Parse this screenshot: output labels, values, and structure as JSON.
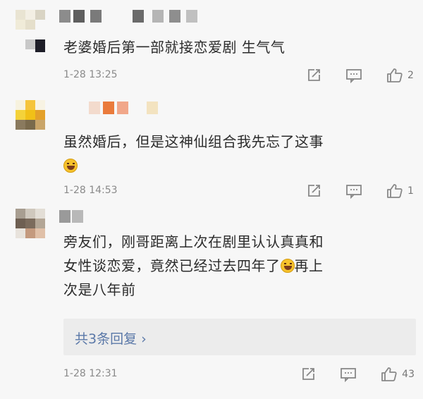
{
  "comments": [
    {
      "text": "老婆婚后第一部就接恋爱剧 生气气",
      "time": "1-28 13:25",
      "likes": "2"
    },
    {
      "text": "虽然婚后，但是这神仙组合我先忘了这事",
      "time": "1-28 14:53",
      "likes": "1"
    },
    {
      "text_line1": "旁友们，刚哥距离上次在剧里认认真真和",
      "text_line2a": "女性谈恋爱，竟然已经过去四年了",
      "text_line2b": "再上",
      "text_line3": "次是八年前",
      "replies_label": "共3条回复 ›",
      "time": "1-28 12:31",
      "likes": "43"
    }
  ],
  "icons": {
    "share": "share-icon",
    "comment": "comment-icon",
    "like": "thumbs-up-icon",
    "emoji": "laughing-emoji"
  },
  "colors": {
    "background": "#f7f7f7",
    "text": "#2b2b2b",
    "meta": "#8a8a8a",
    "link": "#5a78a8"
  }
}
